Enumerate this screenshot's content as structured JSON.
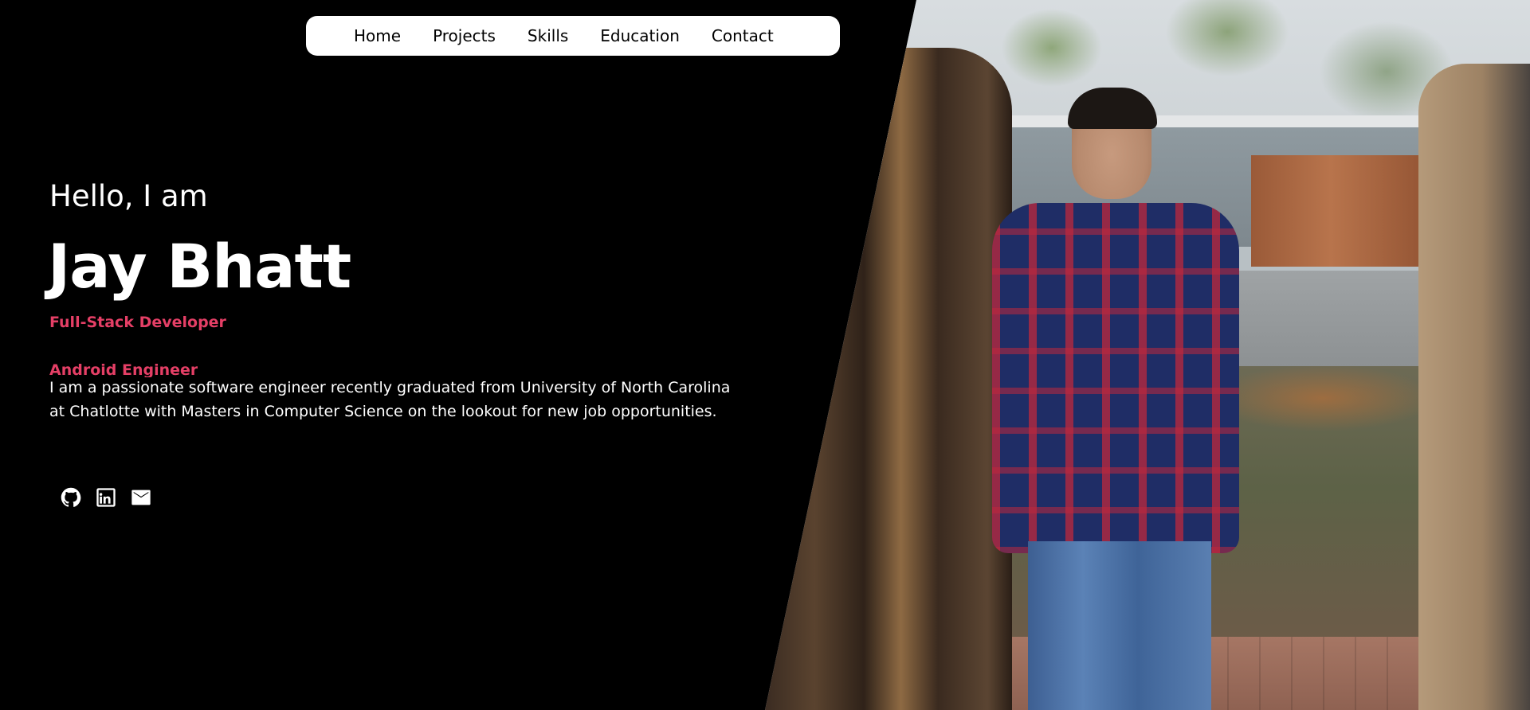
{
  "nav": {
    "items": [
      {
        "label": "Home"
      },
      {
        "label": "Projects"
      },
      {
        "label": "Skills"
      },
      {
        "label": "Education"
      },
      {
        "label": "Contact"
      }
    ]
  },
  "hero": {
    "greeting": "Hello, I am",
    "name": "Jay Bhatt",
    "roles": [
      "Full-Stack Developer",
      "Android Engineer"
    ],
    "bio": "I am a passionate software engineer recently graduated from University of North Carolina at Chatlotte with Masters in Computer Science on the lookout for new job opportunities."
  },
  "socials": [
    {
      "icon": "github-icon"
    },
    {
      "icon": "linkedin-icon"
    },
    {
      "icon": "mail-icon"
    }
  ],
  "colors": {
    "background": "#000000",
    "accent": "#e53f66",
    "nav_background": "#ffffff",
    "text": "#ffffff"
  }
}
